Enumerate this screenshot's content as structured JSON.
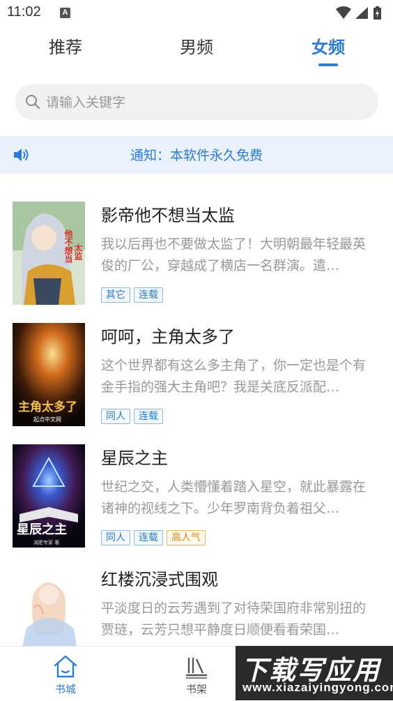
{
  "status": {
    "time": "11:02",
    "notification_badge": "A"
  },
  "tabs": [
    {
      "label": "推荐",
      "active": false
    },
    {
      "label": "男频",
      "active": false
    },
    {
      "label": "女频",
      "active": true
    }
  ],
  "search": {
    "placeholder": "请输入关键字",
    "value": ""
  },
  "notice": {
    "text": "通知：本软件永久免费",
    "icon": "speaker-icon"
  },
  "books": [
    {
      "title": "影帝他不想当太监",
      "description": "我以后再也不要做太监了！大明朝最年轻最英俊的厂公，穿越成了横店一名群演。遣…",
      "tags": [
        "其它",
        "连载"
      ],
      "cover_colors": [
        "#e8d36a",
        "#5a8c3c",
        "#2c3a58"
      ]
    },
    {
      "title": "呵呵，主角太多了",
      "description": "这个世界都有这么多主角了，你一定也是个有金手指的强大主角吧？我是关底反派配…",
      "tags": [
        "同人",
        "连载"
      ],
      "cover_colors": [
        "#1a0d05",
        "#c8661c",
        "#f0c060"
      ]
    },
    {
      "title": "星辰之主",
      "description": "世纪之交，人类懵懂着踏入星空，就此暴露在诸神的视线之下。少年罗南背负着祖父…",
      "tags": [
        "同人",
        "连载",
        "高人气"
      ],
      "cover_colors": [
        "#0a1030",
        "#3a6ad8",
        "#e8a03c"
      ]
    },
    {
      "title": "红楼沉浸式围观",
      "description": "平淡度日的云芳遇到了对待荣国府非常别扭的贾琏，云芳只想平静度日顺便看看荣国…",
      "tags": [],
      "cover_colors": [
        "#f7f3ef",
        "#f2c9b0",
        "#a9c6e8"
      ]
    }
  ],
  "bottom_nav": [
    {
      "label": "书城",
      "icon": "home-icon",
      "active": true
    },
    {
      "label": "书架",
      "icon": "bookshelf-icon",
      "active": false
    }
  ],
  "watermark": {
    "line1": "下载写应用",
    "line2": "www.xiazaiyingyong.com"
  },
  "colors": {
    "accent": "#2b7bd8",
    "notice_bg": "#e9f2fc",
    "hot_tag": "#e08a10"
  }
}
